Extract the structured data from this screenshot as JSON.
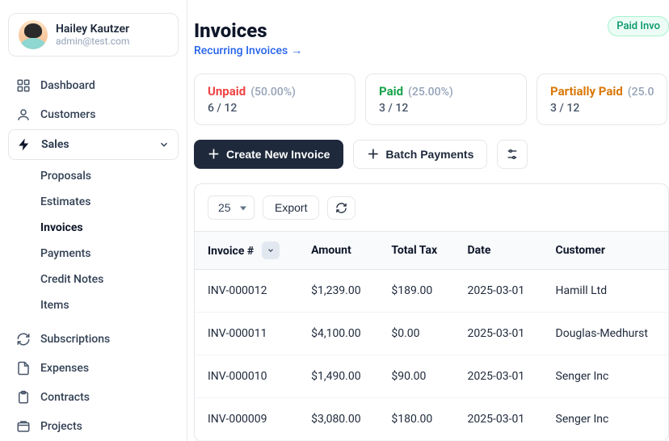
{
  "user": {
    "name": "Hailey Kautzer",
    "email": "admin@test.com"
  },
  "nav": {
    "dashboard": "Dashboard",
    "customers": "Customers",
    "sales": "Sales",
    "subscriptions": "Subscriptions",
    "expenses": "Expenses",
    "contracts": "Contracts",
    "projects": "Projects"
  },
  "sales_sub": {
    "proposals": "Proposals",
    "estimates": "Estimates",
    "invoices": "Invoices",
    "payments": "Payments",
    "credit_notes": "Credit Notes",
    "items": "Items"
  },
  "header": {
    "title": "Invoices",
    "recurring": "Recurring Invoices",
    "badge": "Paid Invo"
  },
  "stats": {
    "unpaid": {
      "label": "Unpaid",
      "pct": "(50.00%)",
      "count": "6 / 12"
    },
    "paid": {
      "label": "Paid",
      "pct": "(25.00%)",
      "count": "3 / 12"
    },
    "partial": {
      "label": "Partially Paid",
      "pct": "(25.0",
      "count": "3 / 12"
    }
  },
  "actions": {
    "create": "Create New Invoice",
    "batch": "Batch Payments"
  },
  "toolbar": {
    "page_size": "25",
    "export": "Export"
  },
  "table": {
    "cols": {
      "id": "Invoice #",
      "amount": "Amount",
      "tax": "Total Tax",
      "date": "Date",
      "customer": "Customer"
    },
    "rows": [
      {
        "id": "INV-000012",
        "amount": "$1,239.00",
        "tax": "$189.00",
        "date": "2025-03-01",
        "customer": "Hamill Ltd"
      },
      {
        "id": "INV-000011",
        "amount": "$4,100.00",
        "tax": "$0.00",
        "date": "2025-03-01",
        "customer": "Douglas-Medhurst"
      },
      {
        "id": "INV-000010",
        "amount": "$1,490.00",
        "tax": "$90.00",
        "date": "2025-03-01",
        "customer": "Senger Inc"
      },
      {
        "id": "INV-000009",
        "amount": "$3,080.00",
        "tax": "$180.00",
        "date": "2025-03-01",
        "customer": "Senger Inc"
      }
    ]
  }
}
